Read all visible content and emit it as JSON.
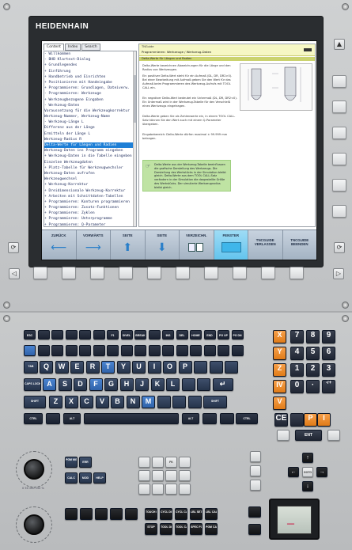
{
  "brand": "HEIDENHAIN",
  "help": {
    "tabs": [
      {
        "label": "Content",
        "active": true
      },
      {
        "label": "Index",
        "active": false
      },
      {
        "label": "Search",
        "active": false
      }
    ],
    "tree": [
      {
        "text": "- Willkommen",
        "selected": false
      },
      {
        "text": "- BHB Klartext-Dialog",
        "selected": false
      },
      {
        "text": "  + Grundlegendes",
        "selected": false
      },
      {
        "text": "  + Einführung",
        "selected": false
      },
      {
        "text": "  + Handbetrieb und Einrichten",
        "selected": false
      },
      {
        "text": "  + Positionieren mit Handeingabe",
        "selected": false
      },
      {
        "text": "  + Programmieren: Grundlagen, Dateiverw.",
        "selected": false
      },
      {
        "text": "  - Programmieren: Werkzeuge",
        "selected": false
      },
      {
        "text": "    + Werkzeugbezogene Eingaben",
        "selected": false
      },
      {
        "text": "    - Werkzeug-Daten",
        "selected": false
      },
      {
        "text": "        Voraussetzung für die Werkzeugkorrektur",
        "selected": false
      },
      {
        "text": "        Werkzeug-Nummer, Werkzeug-Name",
        "selected": false
      },
      {
        "text": "      - Werkzeug-Länge L",
        "selected": false
      },
      {
        "text": "          Differenz aus der Länge",
        "selected": false
      },
      {
        "text": "          Ermitteln der Länge L",
        "selected": false
      },
      {
        "text": "        Werkzeug-Radius R",
        "selected": false
      },
      {
        "text": "        Delta-Werte für Längen und Radien",
        "selected": true
      },
      {
        "text": "        Werkzeug-Daten ins Programm eingeben",
        "selected": false
      },
      {
        "text": "      + Werkzeug-Daten in die Tabelle eingeben",
        "selected": false
      },
      {
        "text": "        Einzelne Werkzeugdaten",
        "selected": false
      },
      {
        "text": "      + Platz-Tabelle für Werkzeugwechsler",
        "selected": false
      },
      {
        "text": "        Werkzeug-Daten aufrufen",
        "selected": false
      },
      {
        "text": "        Werkzeugwechsel",
        "selected": false
      },
      {
        "text": "    + Werkzeug-Korrektur",
        "selected": false
      },
      {
        "text": "    + Dreidimensionale Werkzeug-Korrektur",
        "selected": false
      },
      {
        "text": "    + Arbeiten mit Schnittdaten-Tabellen",
        "selected": false
      },
      {
        "text": "  + Programmieren: Konturen programmieren",
        "selected": false
      },
      {
        "text": "  + Programmieren: Zusatz-Funktionen",
        "selected": false
      },
      {
        "text": "  + Programmieren: Zyklen",
        "selected": false
      },
      {
        "text": "  + Programmieren: Unterprogramme",
        "selected": false
      },
      {
        "text": "  + Programmieren: Q-Parameter",
        "selected": false
      }
    ],
    "doc": {
      "path": "TNGuide",
      "title": "Programmieren: Werkzeuge / Werkzeug-Daten",
      "heading": "Delta-Werte für Längen und Radien",
      "paragraphs": [
        "Delta-Werte bezeichnen Abweichungen für die Länge und den Radius von Werkzeugen.",
        "Ein positiver Delta-Wert steht für ein Aufmaß (DL, DR, DR2>0). Bei einer Bearbeitung mit Aufmaß geben Sie den Wert für das Aufmaß beim Programmieren des Werkzeug-Aufrufs mit TOOL CALL ein.",
        "Ein negativer Delta-Wert bedeutet ein Untermaß (DL, DR, DR2<0). Ein Untermaß wird in der Werkzeug-Tabelle für den Verschleiß eines Werkzeugs eingetragen.",
        "Delta-Werte geben Sie als Zahlenwerte ein, in einem TOOL CALL-Satz können Sie den Wert auch mit einem Q-Parameter übergeben.",
        "Eingabebereich: Delta-Werte dürfen maximal ± 99.999 mm betragen."
      ],
      "note": "Delta-Werte aus der Werkzeug-Tabelle beeinflussen die grafische Darstellung des Werkzeugs. Die Darstellung des Werkstücks in der Simulation bleibt gleich. Delta-Werte aus dem TOOL CALL-Satz verändern in der Simulation die dargestellte Größe des Werkstücks. Der simulierte Werkzeugradius bleibt gleich."
    },
    "softkeys": [
      {
        "label": "ZURÜCK",
        "arrow": "⟵"
      },
      {
        "label": "VORWÄRTS",
        "arrow": "⟶"
      },
      {
        "label": "SEITE",
        "arrow": "⬆"
      },
      {
        "label": "SEITE",
        "arrow": "⬇"
      },
      {
        "label": "VERZEICHN.",
        "arrow": ""
      },
      {
        "label": "FENSTER",
        "arrow": ""
      },
      {
        "label": "TNCGUIDE VERLASSEN",
        "arrow": ""
      },
      {
        "label": "TNCGUIDE BEENDEN",
        "arrow": ""
      }
    ]
  },
  "keyboard": {
    "fn_row": [
      "ESC",
      "",
      "",
      "",
      "",
      "",
      "F1",
      "DIVEL",
      "BREAK",
      "",
      "INS",
      "DEL",
      "HOME",
      "END",
      "PG UP",
      "PG DN"
    ],
    "row_qwerty": [
      "TAB",
      "Q",
      "W",
      "E",
      "R",
      "T",
      "Y",
      "U",
      "I",
      "O",
      "P",
      "",
      "",
      ""
    ],
    "row_asdf": [
      "CAPS LOCK",
      "A",
      "S",
      "D",
      "F",
      "G",
      "H",
      "J",
      "K",
      "L",
      "",
      "",
      "↵"
    ],
    "row_zxcv": [
      "SHIFT",
      "Z",
      "X",
      "C",
      "V",
      "B",
      "N",
      "M",
      "",
      "",
      "",
      "SHIFT"
    ],
    "row_ctrl": [
      "CTRL",
      "",
      "ALT",
      "",
      "ALT",
      "",
      "",
      "CTRL"
    ],
    "axis_keys": [
      "X",
      "Y",
      "Z",
      "IV",
      "V"
    ],
    "numpad": [
      "7",
      "8",
      "9",
      "4",
      "5",
      "6",
      "1",
      "2",
      "3",
      "0",
      "·",
      "-/+",
      "CE",
      "",
      "P",
      "I"
    ],
    "ent": "ENT"
  },
  "lower": {
    "knob_label": "0  50  100  150 %",
    "mode_keys": [
      "PGM MGT",
      "ERR",
      "CALC",
      "MOD",
      "HELP"
    ],
    "mid_keys": [
      "",
      "",
      "FK",
      "",
      "",
      "",
      "",
      "",
      "",
      "",
      "",
      ""
    ],
    "bottom_keys": [
      "",
      "",
      "",
      "",
      "",
      "TOUCH PROBE",
      "CYCL DEF",
      "CYCL CALL",
      "LBL SET",
      "LBL CALL",
      "STOP",
      "TOOL DEF",
      "TOOL CALL",
      "SPEC FCT",
      "PGM CALL"
    ],
    "nav": {
      "goto": "GOTO"
    }
  }
}
